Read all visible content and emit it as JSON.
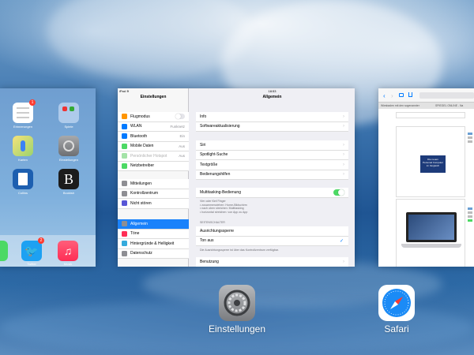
{
  "switcher": {
    "apps": [
      {
        "label": "Einstellungen"
      },
      {
        "label": "Safari"
      }
    ]
  },
  "home": {
    "apps": [
      {
        "label": "Erinnerungen",
        "badge": "1"
      },
      {
        "label": "Spiele"
      },
      {
        "label": "Karten"
      },
      {
        "label": "Einstellungen"
      },
      {
        "label": "Collins"
      },
      {
        "label": "Bookish"
      }
    ],
    "dock": [
      {
        "label": "Twitter",
        "badge": "2"
      },
      {
        "label": "Musik"
      }
    ]
  },
  "settings": {
    "status_left": "iPad ≋",
    "status_time": "18:53",
    "sidebar_title": "Einstellungen",
    "main_title": "Allgemein",
    "sidebar_group1": [
      {
        "label": "Flugmodus",
        "icon": "airplane-icon",
        "color": "#ff9500"
      },
      {
        "label": "WLAN",
        "value": "Funknetz",
        "icon": "wifi-icon",
        "color": "#007aff"
      },
      {
        "label": "Bluetooth",
        "value": "Ein",
        "icon": "bluetooth-icon",
        "color": "#007aff"
      },
      {
        "label": "Mobile Daten",
        "value": "Aus",
        "icon": "antenna-icon",
        "color": "#4cd964"
      },
      {
        "label": "Persönlicher Hotspot",
        "value": "Aus",
        "icon": "hotspot-icon",
        "color": "#a4e3a8"
      },
      {
        "label": "Netzbetreiber",
        "icon": "phone-icon",
        "color": "#4cd964"
      }
    ],
    "sidebar_group2": [
      {
        "label": "Mitteilungen",
        "icon": "notifications-icon",
        "color": "#8e8e93"
      },
      {
        "label": "Kontrollzentrum",
        "icon": "control-center-icon",
        "color": "#8e8e93"
      },
      {
        "label": "Nicht stören",
        "icon": "moon-icon",
        "color": "#5856d6"
      }
    ],
    "sidebar_group3": [
      {
        "label": "Allgemein",
        "icon": "gear-icon",
        "color": "#8e8e93"
      },
      {
        "label": "Töne",
        "icon": "speaker-icon",
        "color": "#ff2d55"
      },
      {
        "label": "Hintergründe & Helligkeit",
        "icon": "flower-icon",
        "color": "#34aadc"
      },
      {
        "label": "Datenschutz",
        "icon": "hand-icon",
        "color": "#8e8e93"
      }
    ],
    "main_group1": [
      "Info",
      "Softwareaktualisierung"
    ],
    "main_group2": [
      "Siri",
      "Spotlight-Suche",
      "Textgröße",
      "Bedienungshilfen"
    ],
    "main_group3_label": "Multitasking-Bedienung",
    "multitasking_note": [
      "Vier oder fünf Finger",
      "• zusammenziehen: Home-Bildschirm",
      "• nach oben streichen: Multitasking",
      "• horizontal streichen: von App zu App"
    ],
    "section_header": "SEITENSCHALTER",
    "side_switch": [
      "Ausrichtungssperre",
      "Ton aus"
    ],
    "side_switch_note": "Die Ausrichtungssperre ist über das Kontrollzentrum verfügbar.",
    "main_group5": [
      "Benutzung"
    ]
  },
  "safari": {
    "tabs": [
      "Wiesbaden mit den sogenannten...",
      "SPIEGEL ONLINE - Na"
    ],
    "items": [
      {
        "text": "Die neuen Personal Computer im Vergleich"
      }
    ]
  }
}
